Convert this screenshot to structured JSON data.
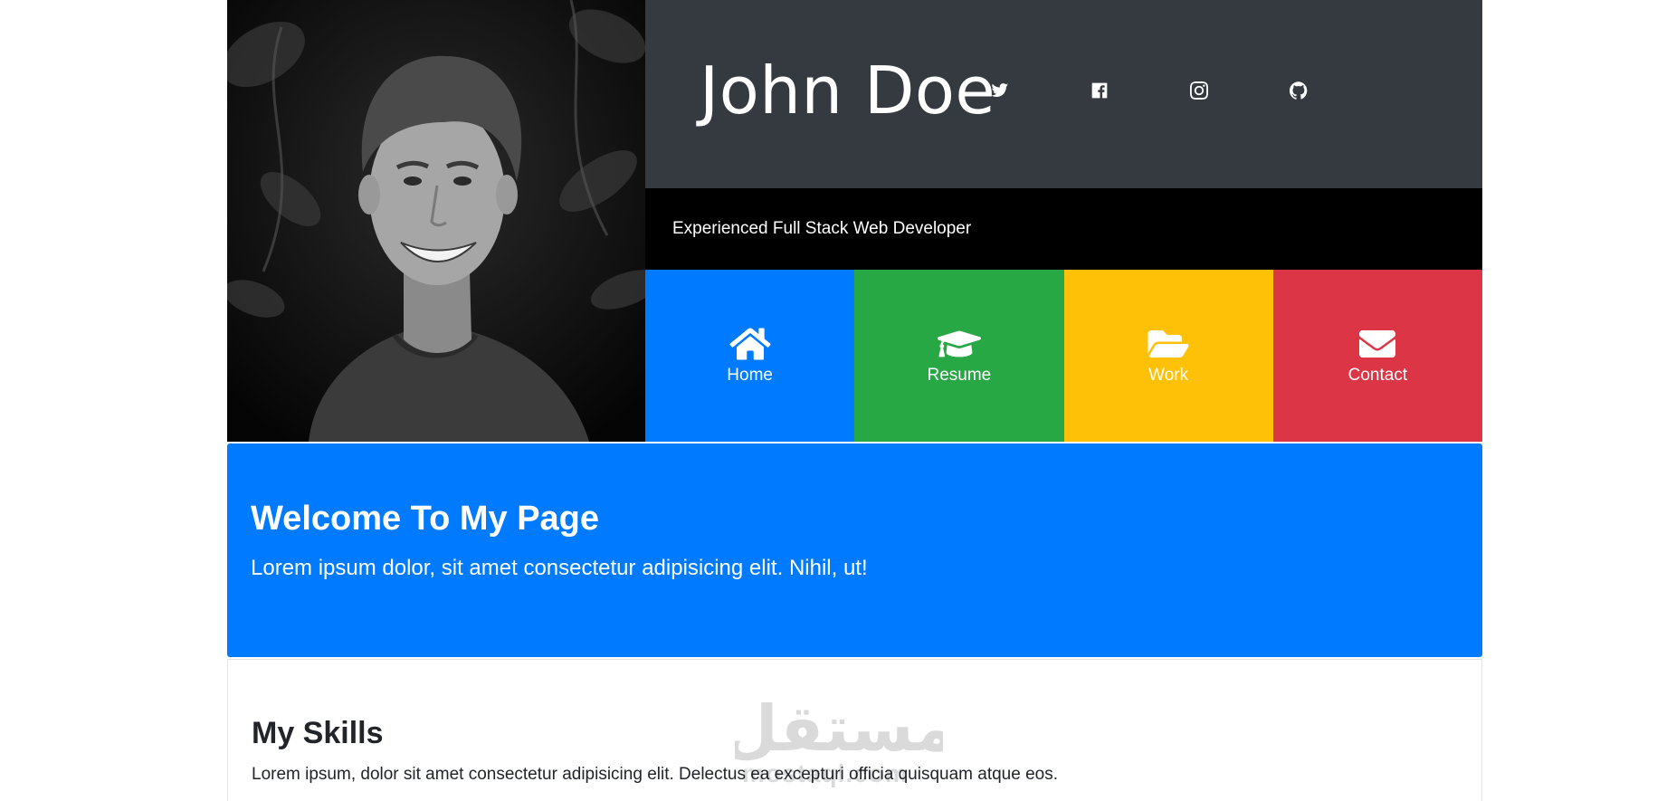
{
  "header": {
    "name": "John Doe",
    "tagline": "Experienced Full Stack Web Developer",
    "social": [
      {
        "icon": "twitter-icon"
      },
      {
        "icon": "facebook-icon"
      },
      {
        "icon": "instagram-icon"
      },
      {
        "icon": "github-icon"
      }
    ]
  },
  "nav": [
    {
      "label": "Home",
      "icon": "home-icon",
      "color": "#007bff"
    },
    {
      "label": "Resume",
      "icon": "graduation-cap-icon",
      "color": "#28a745"
    },
    {
      "label": "Work",
      "icon": "folder-open-icon",
      "color": "#ffc107"
    },
    {
      "label": "Contact",
      "icon": "envelope-icon",
      "color": "#dc3545"
    }
  ],
  "welcome": {
    "title": "Welcome To My Page",
    "text": "Lorem ipsum dolor, sit amet consectetur adipisicing elit. Nihil, ut!"
  },
  "skills": {
    "title": "My Skills",
    "text": "Lorem ipsum, dolor sit amet consectetur adipisicing elit. Delectus ea excepturi officia quisquam atque eos."
  },
  "watermark": {
    "arabic": "مستقل",
    "latin": "mostaql.com"
  },
  "colors": {
    "dark": "#343a40",
    "black": "#000000",
    "primary": "#007bff",
    "success": "#28a745",
    "warning": "#ffc107",
    "danger": "#dc3545"
  }
}
